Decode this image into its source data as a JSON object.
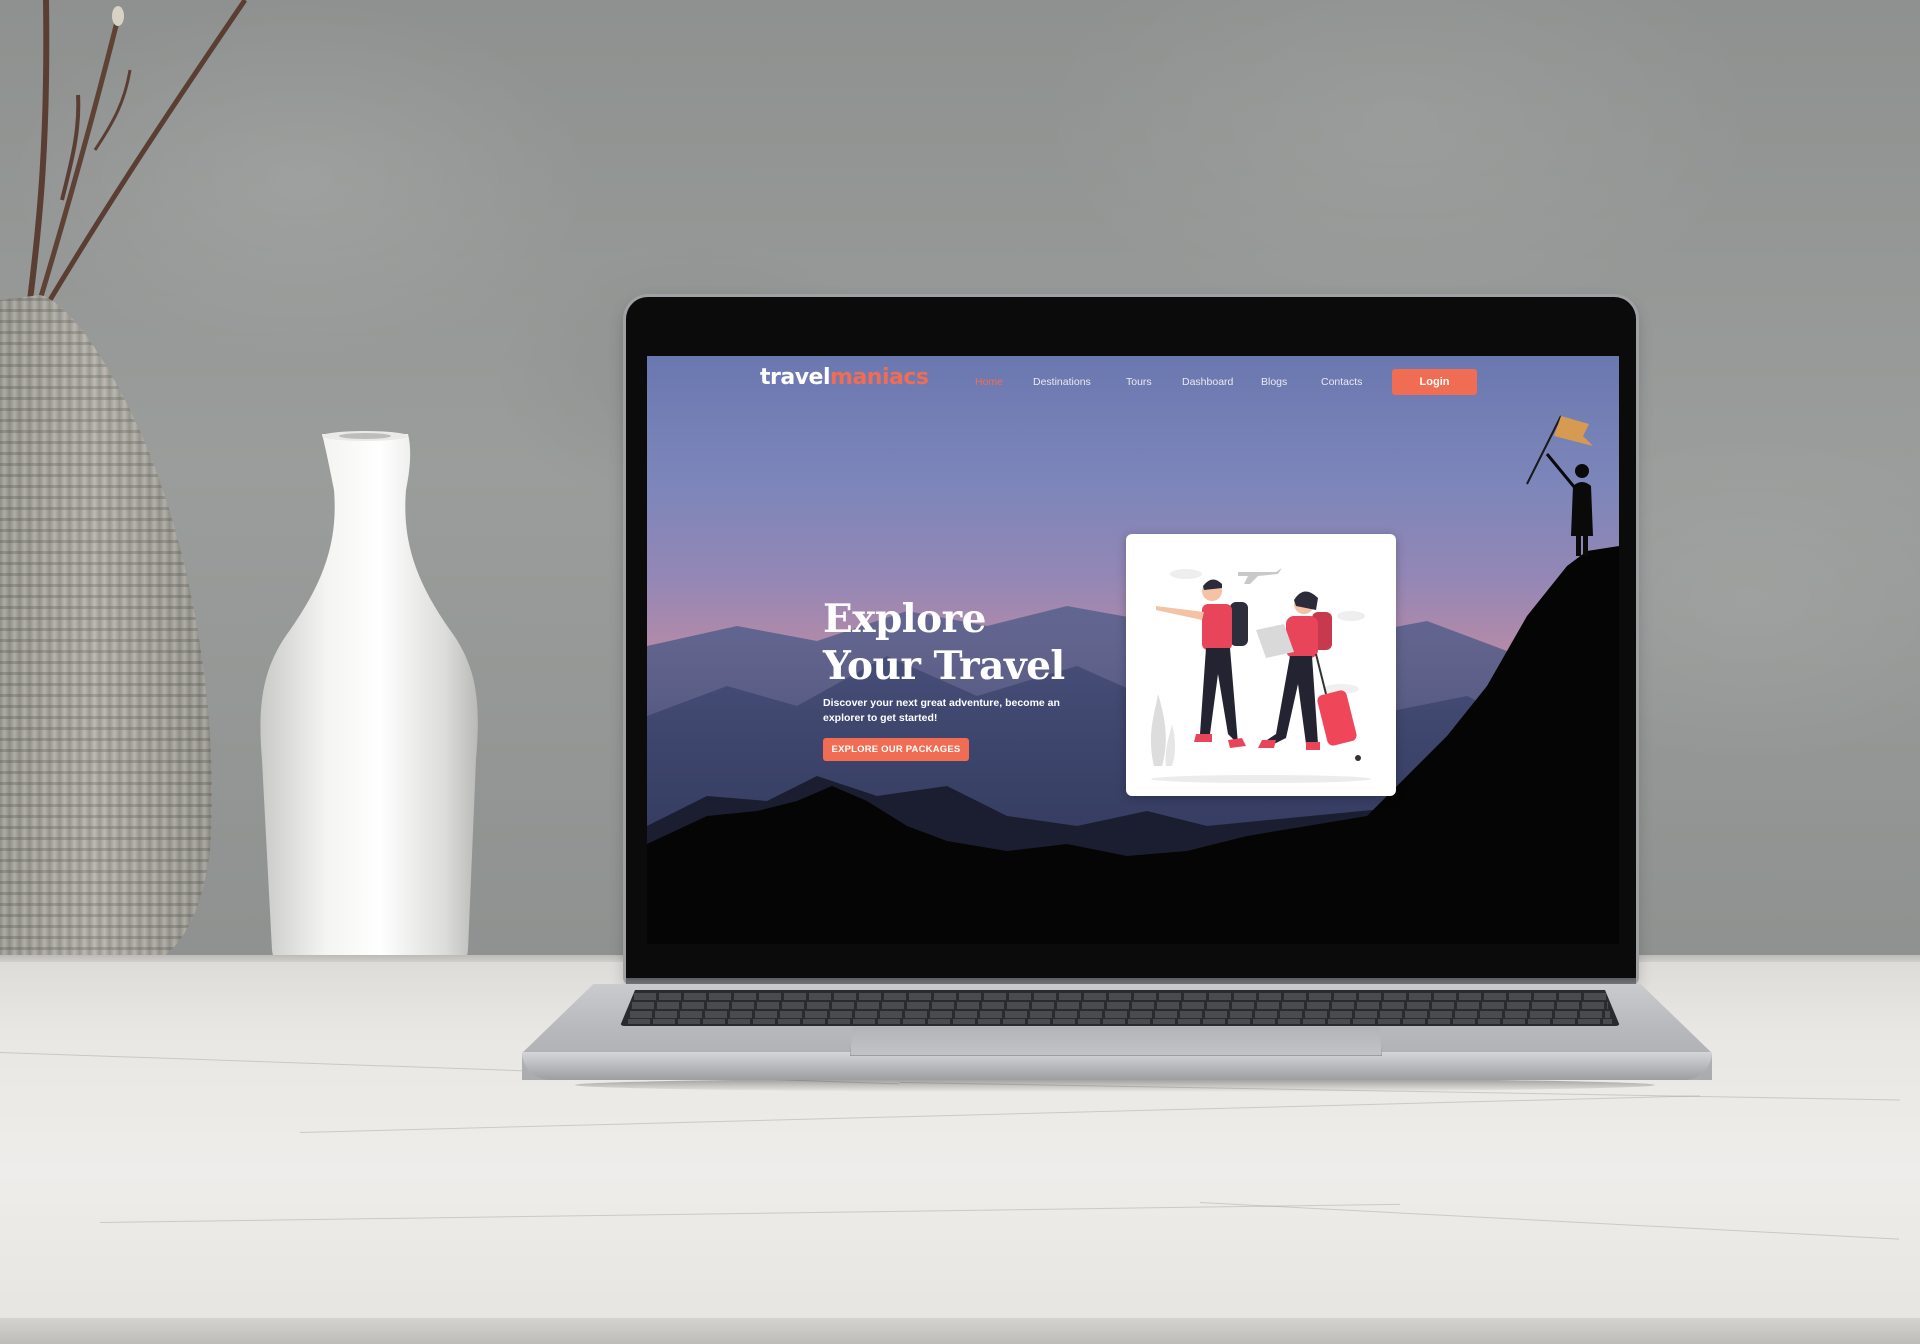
{
  "site": {
    "logo": {
      "part1": "travel",
      "part2": "maniacs"
    },
    "nav": [
      {
        "label": "Home",
        "active": true
      },
      {
        "label": "Destinations"
      },
      {
        "label": "Tours"
      },
      {
        "label": "Dashboard"
      },
      {
        "label": "Blogs"
      },
      {
        "label": "Contacts"
      }
    ],
    "login_label": "Login",
    "hero": {
      "title_line1": "Explore",
      "title_line2": "Your Travel",
      "subtitle": "Discover your next great adventure, become an explorer to get started!",
      "cta_label": "EXPLORE OUR PACKAGES"
    },
    "illustration": "travelers-illustration",
    "summit_figure": "flag-climber-silhouette"
  },
  "colors": {
    "accent": "#f06c52",
    "sky_top": "#6a78b0",
    "sky_glow": "#b48aa8",
    "silhouette": "#050505"
  }
}
